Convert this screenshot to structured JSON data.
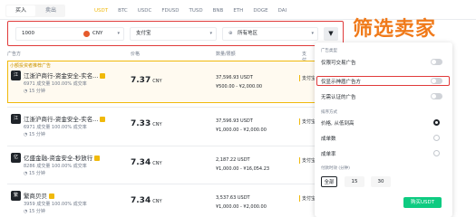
{
  "topbar": {
    "trade_tabs": [
      "买入",
      "卖出"
    ],
    "coins": [
      "USDT",
      "BTC",
      "USDC",
      "FDUSD",
      "TUSD",
      "BNB",
      "ETH",
      "DOGE",
      "DAI"
    ]
  },
  "filters": {
    "amount_value": "1000",
    "currency": "CNY",
    "payment": "支付宝",
    "region": "所有地区",
    "filter_icon": "funnel-icon"
  },
  "overlay_title": "筛选卖家",
  "table": {
    "headers": [
      "广告方",
      "价格",
      "数量/限额",
      "支付方式"
    ],
    "promo_label": "小额投资者推荐广告",
    "rows": [
      {
        "avatar": "江",
        "name": "江浙沪商行-资金安全-实名...",
        "stats": "6971 成交量   100.00% 成交率",
        "time": "15 分钟",
        "price": "7.37",
        "currency": "CNY",
        "available": "37,596.93 USDT",
        "limit": "¥500.00 - ¥2,000.00",
        "pay": "支付宝"
      },
      {
        "avatar": "江",
        "name": "江浙沪商行-资金安全-实名...",
        "stats": "6971 成交量   100.00% 成交率",
        "time": "15 分钟",
        "price": "7.33",
        "currency": "CNY",
        "available": "37,596.93 USDT",
        "limit": "¥1,000.00 - ¥2,000.00",
        "pay": "支付宝"
      },
      {
        "avatar": "亿",
        "name": "亿盛金融-资金安全-秒放行",
        "stats": "8286 成交量   100.00% 成交率",
        "time": "15 分钟",
        "price": "7.34",
        "currency": "CNY",
        "available": "2,187.22 USDT",
        "limit": "¥1,000.00 - ¥16,054.23",
        "pay": "支付宝"
      },
      {
        "avatar": "繁",
        "name": "繁商贝贝",
        "stats": "3959 成交量   100.00% 成交率",
        "time": "15 分钟",
        "price": "7.34",
        "currency": "CNY",
        "available": "3,537.63 USDT",
        "limit": "¥1,000.00 - ¥2,000.00",
        "pay": "支付宝"
      }
    ]
  },
  "dropdown": {
    "ad_type_section": "广告类型",
    "opt_tradable": "仅限可交易广告",
    "opt_verified": "仅显示神盾广告方",
    "opt_no_verify": "无需认证的广告",
    "sort_section": "排序方式",
    "sort_options": [
      "价格, 从低到高",
      "成单数",
      "成单率"
    ],
    "pay_time_section": "付款时效 (分钟)",
    "pay_times": [
      "全部",
      "15",
      "30"
    ],
    "buy_button": "购买USDT"
  },
  "colors": {
    "accent": "#f0b90b",
    "highlight": "#e03a3a",
    "overlay_text": "#f07a1a",
    "buy": "#0ecb81"
  }
}
